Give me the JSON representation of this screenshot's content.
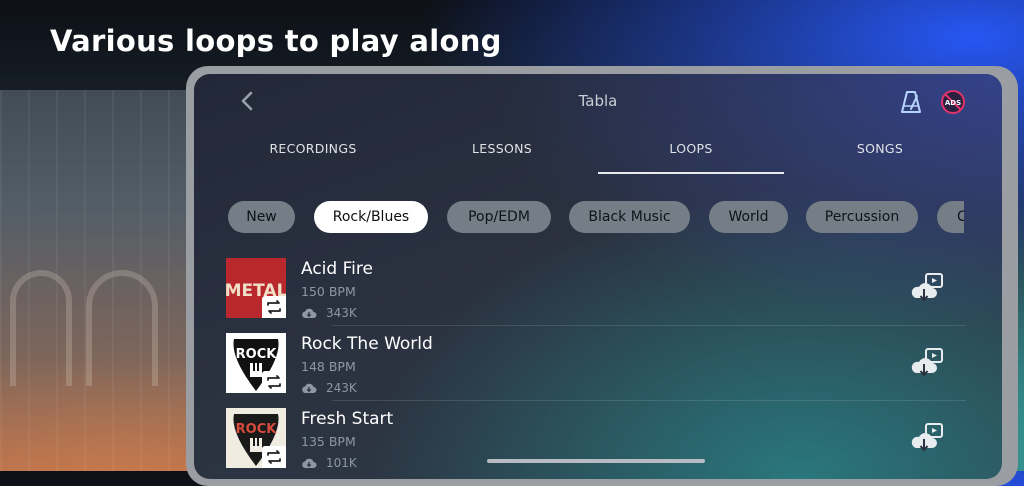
{
  "headline": "Various loops to play along",
  "app": {
    "title": "Tabla",
    "back_icon": "chevron-left-icon",
    "metronome_icon": "metronome-icon",
    "ads_icon": "no-ads-icon",
    "ads_label": "ADS"
  },
  "tabs": [
    {
      "label": "RECORDINGS",
      "active": false
    },
    {
      "label": "LESSONS",
      "active": false
    },
    {
      "label": "LOOPS",
      "active": true
    },
    {
      "label": "SONGS",
      "active": false
    }
  ],
  "chips": [
    {
      "label": "New",
      "active": false
    },
    {
      "label": "Rock/Blues",
      "active": true
    },
    {
      "label": "Pop/EDM",
      "active": false
    },
    {
      "label": "Black Music",
      "active": false
    },
    {
      "label": "World",
      "active": false
    },
    {
      "label": "Percussion",
      "active": false
    },
    {
      "label": "C",
      "active": false
    }
  ],
  "loops": [
    {
      "title": "Acid Fire",
      "bpm": "150 BPM",
      "downloads": "343K",
      "thumb_text": "METAL",
      "thumb_color": "#b8282c"
    },
    {
      "title": "Rock The World",
      "bpm": "148 BPM",
      "downloads": "243K",
      "thumb_text": "ROCK",
      "thumb_color": "#ffffff"
    },
    {
      "title": "Fresh Start",
      "bpm": "135 BPM",
      "downloads": "101K",
      "thumb_text": "ROCK",
      "thumb_color": "#f1ece2"
    }
  ]
}
